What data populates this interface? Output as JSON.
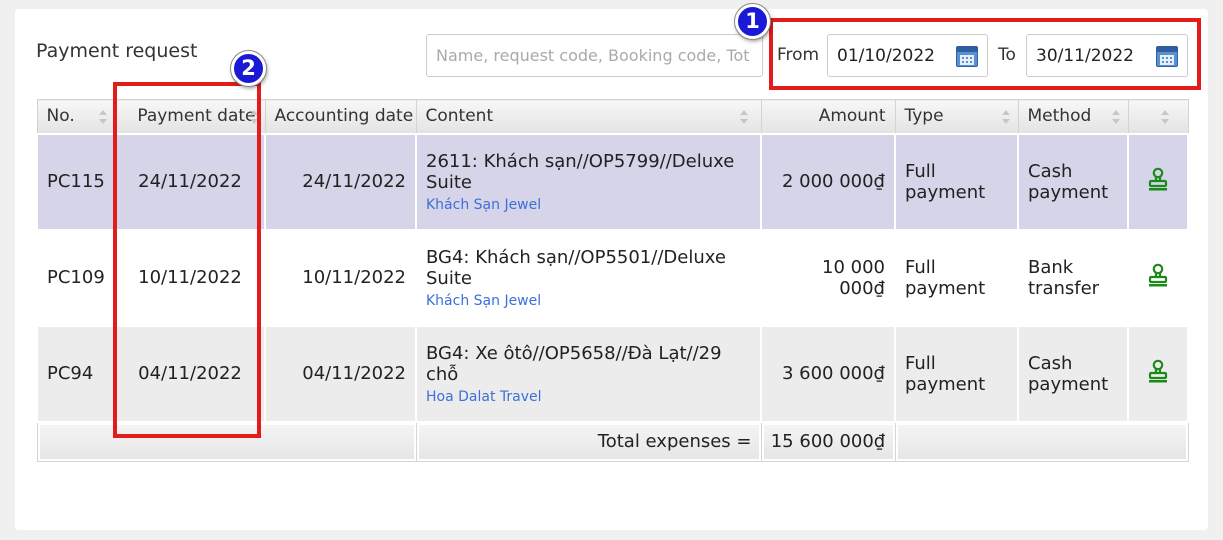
{
  "panel": {
    "title": "Payment request",
    "search_placeholder": "Name, request code, Booking code, Tot",
    "from_label": "From",
    "from_date": "01/10/2022",
    "to_label": "To",
    "to_date": "30/11/2022"
  },
  "annotations": {
    "badge1": "1",
    "badge2": "2"
  },
  "table": {
    "headers": [
      "No.",
      "Payment date",
      "Accounting date",
      "Content",
      "Amount",
      "Type",
      "Method",
      ""
    ],
    "rows": [
      {
        "no": "PC115",
        "payment_date": "24/11/2022",
        "accounting_date": "24/11/2022",
        "content": "2611: Khách sạn//OP5799//Deluxe Suite",
        "supplier": "Khách Sạn Jewel",
        "amount": "2 000 000₫",
        "type": "Full payment",
        "method": "Cash payment"
      },
      {
        "no": "PC109",
        "payment_date": "10/11/2022",
        "accounting_date": "10/11/2022",
        "content": "BG4: Khách sạn//OP5501//Deluxe Suite",
        "supplier": "Khách Sạn Jewel",
        "amount": "10 000 000₫",
        "type": "Full payment",
        "method": "Bank transfer"
      },
      {
        "no": "PC94",
        "payment_date": "04/11/2022",
        "accounting_date": "04/11/2022",
        "content": "BG4: Xe ôtô//OP5658//Đà Lạt//29 chỗ",
        "supplier": "Hoa Dalat Travel",
        "amount": "3 600 000₫",
        "type": "Full payment",
        "method": "Cash payment"
      }
    ],
    "total_label": "Total expenses =",
    "total_value": "15 600 000₫"
  },
  "colors": {
    "highlight_row": "#d5d4e8",
    "annotation_red": "#e31b1b",
    "badge_blue": "#1a1ad6",
    "link": "#3e6ed8",
    "stamp_green": "#1a8a1a"
  }
}
